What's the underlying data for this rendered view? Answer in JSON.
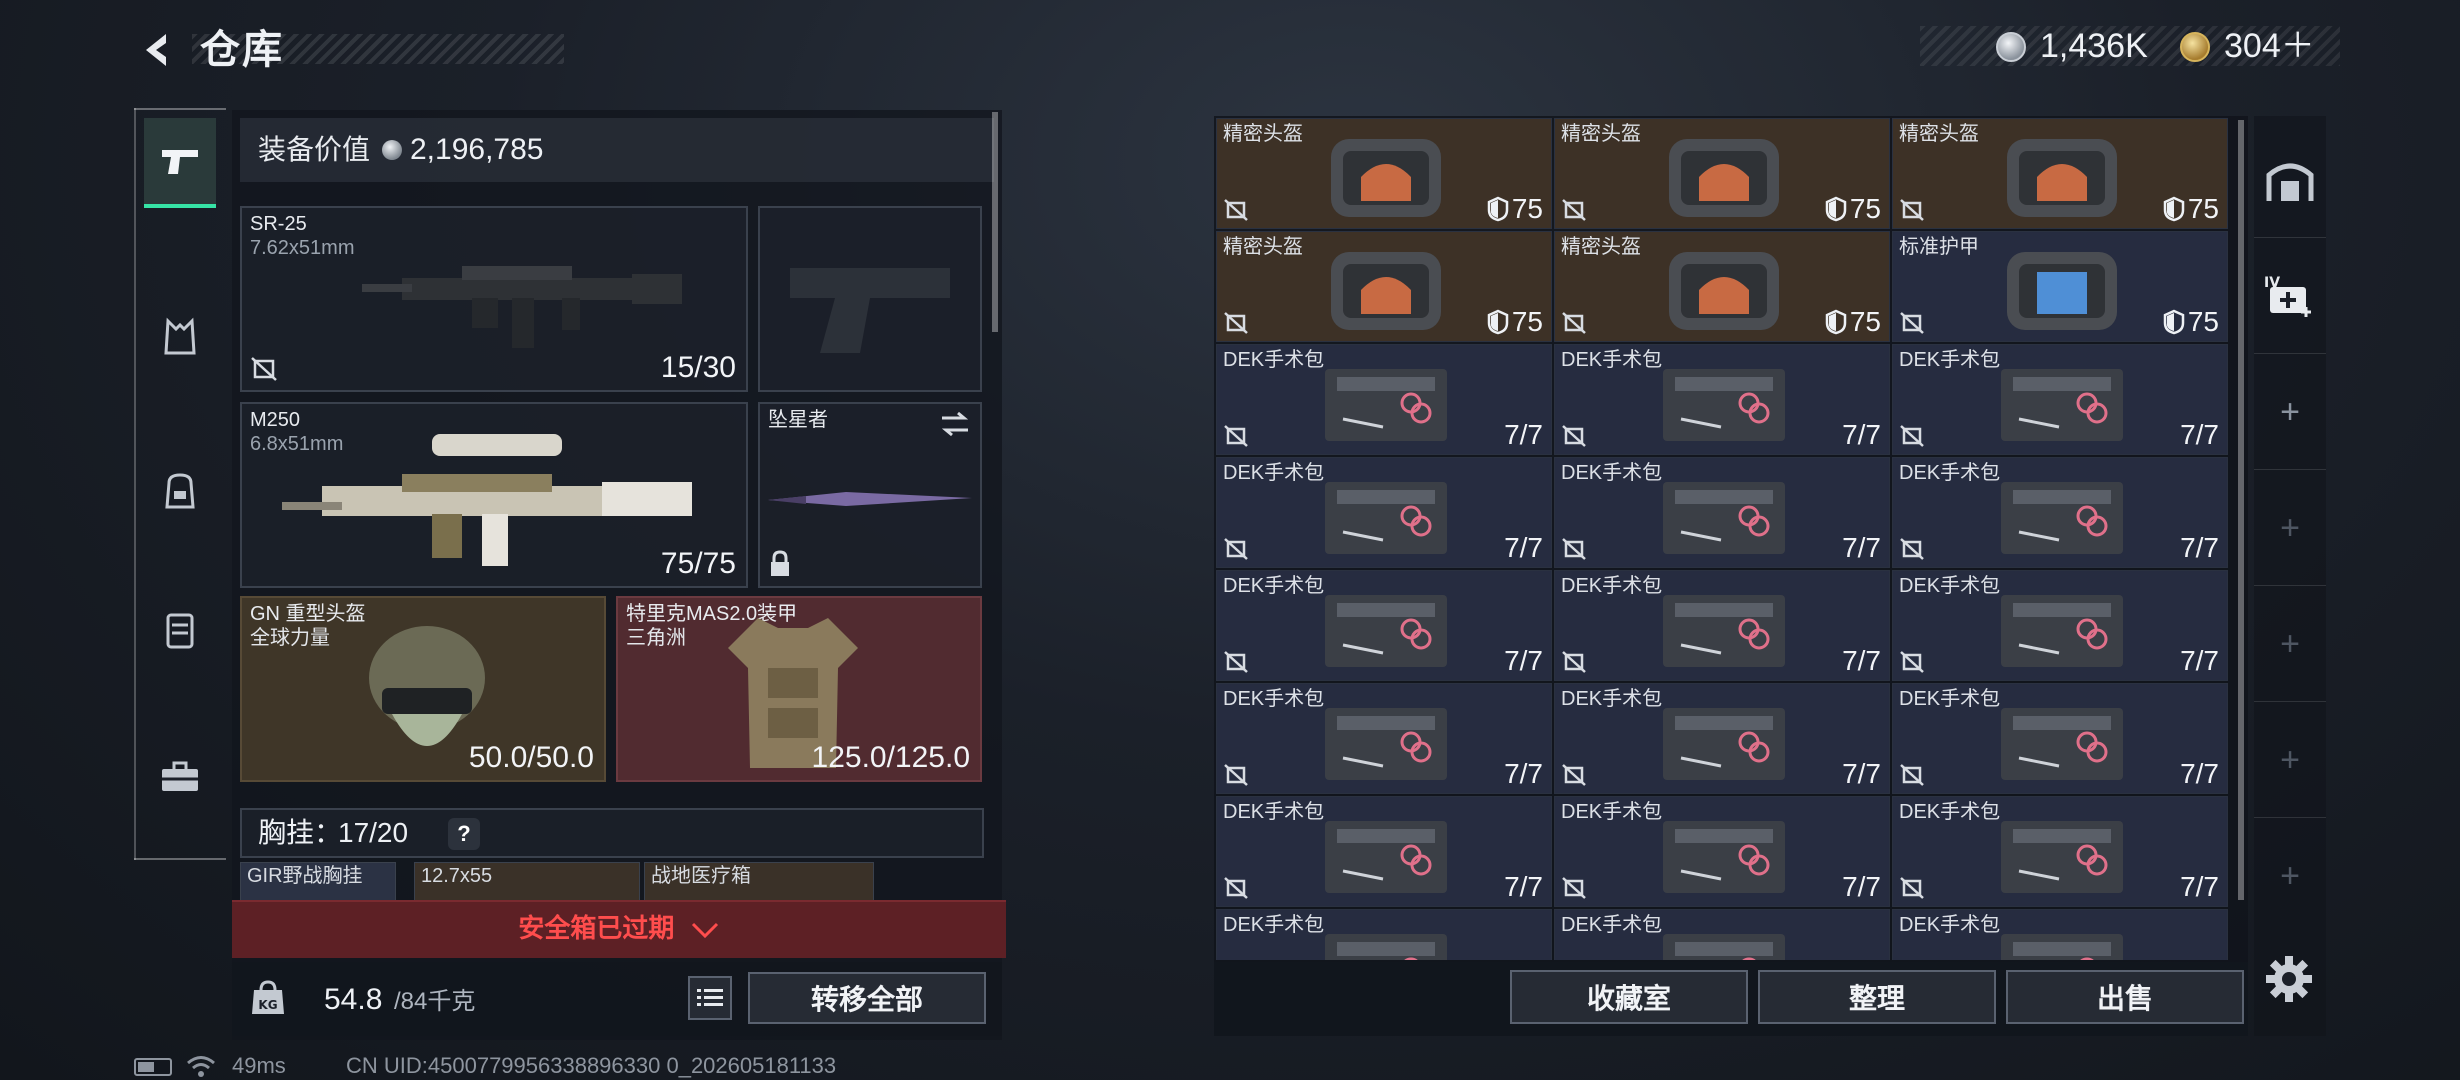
{
  "header": {
    "title": "仓库",
    "currency_silver": "1,436K",
    "currency_gold": "304＋"
  },
  "loadout": {
    "equip_value_label": "装备价值",
    "equip_value": "2,196,785",
    "slots": {
      "primary": {
        "name": "SR-25",
        "caliber": "7.62x51mm",
        "ammo": "15/30"
      },
      "secondary": {
        "name": "M250",
        "caliber": "6.8x51mm",
        "ammo": "75/75"
      },
      "melee": {
        "name": "坠星者"
      },
      "helmet": {
        "name": "GN 重型头盔",
        "faction": "全球力量",
        "durability": "50.0/50.0"
      },
      "armor": {
        "name": "特里克MAS2.0装甲",
        "faction": "三角洲",
        "durability": "125.0/125.0"
      }
    },
    "vest": {
      "label": "胸挂：",
      "capacity": "17/20",
      "help": "?",
      "items": [
        "GIR野战胸挂",
        "12.7x55",
        "战地医疗箱"
      ]
    },
    "safebox_warning": "安全箱已过期",
    "weight": "54.8",
    "weight_max": "/84千克",
    "transfer_all": "转移全部"
  },
  "storage": {
    "rows": [
      [
        {
          "name": "精密头盔",
          "kind": "helmet",
          "value": "75"
        },
        {
          "name": "精密头盔",
          "kind": "helmet",
          "value": "75"
        },
        {
          "name": "精密头盔",
          "kind": "helmet",
          "value": "75"
        }
      ],
      [
        {
          "name": "精密头盔",
          "kind": "helmet",
          "value": "75"
        },
        {
          "name": "精密头盔",
          "kind": "helmet",
          "value": "75"
        },
        {
          "name": "标准护甲",
          "kind": "armor",
          "value": "75"
        }
      ],
      [
        {
          "name": "DEK手术包",
          "kind": "kit",
          "value": "7/7"
        },
        {
          "name": "DEK手术包",
          "kind": "kit",
          "value": "7/7"
        },
        {
          "name": "DEK手术包",
          "kind": "kit",
          "value": "7/7"
        }
      ],
      [
        {
          "name": "DEK手术包",
          "kind": "kit",
          "value": "7/7"
        },
        {
          "name": "DEK手术包",
          "kind": "kit",
          "value": "7/7"
        },
        {
          "name": "DEK手术包",
          "kind": "kit",
          "value": "7/7"
        }
      ],
      [
        {
          "name": "DEK手术包",
          "kind": "kit",
          "value": "7/7"
        },
        {
          "name": "DEK手术包",
          "kind": "kit",
          "value": "7/7"
        },
        {
          "name": "DEK手术包",
          "kind": "kit",
          "value": "7/7"
        }
      ],
      [
        {
          "name": "DEK手术包",
          "kind": "kit",
          "value": "7/7"
        },
        {
          "name": "DEK手术包",
          "kind": "kit",
          "value": "7/7"
        },
        {
          "name": "DEK手术包",
          "kind": "kit",
          "value": "7/7"
        }
      ],
      [
        {
          "name": "DEK手术包",
          "kind": "kit",
          "value": "7/7"
        },
        {
          "name": "DEK手术包",
          "kind": "kit",
          "value": "7/7"
        },
        {
          "name": "DEK手术包",
          "kind": "kit",
          "value": "7/7"
        }
      ],
      [
        {
          "name": "DEK手术包",
          "kind": "kit",
          "value": ""
        },
        {
          "name": "DEK手术包",
          "kind": "kit",
          "value": ""
        },
        {
          "name": "DEK手术包",
          "kind": "kit",
          "value": ""
        }
      ]
    ],
    "buttons": {
      "collection": "收藏室",
      "sort": "整理",
      "sell": "出售"
    }
  },
  "right_rail": {
    "slot_label": "IV"
  },
  "status": {
    "ping": "49ms",
    "uid": "CN UID:4500779956338896330 0_202605181133"
  },
  "colors": {
    "accent": "#36e4a6",
    "warning": "#ff4d4d",
    "helmet_bg": "#3f3628",
    "armor_bg": "#512b30"
  }
}
